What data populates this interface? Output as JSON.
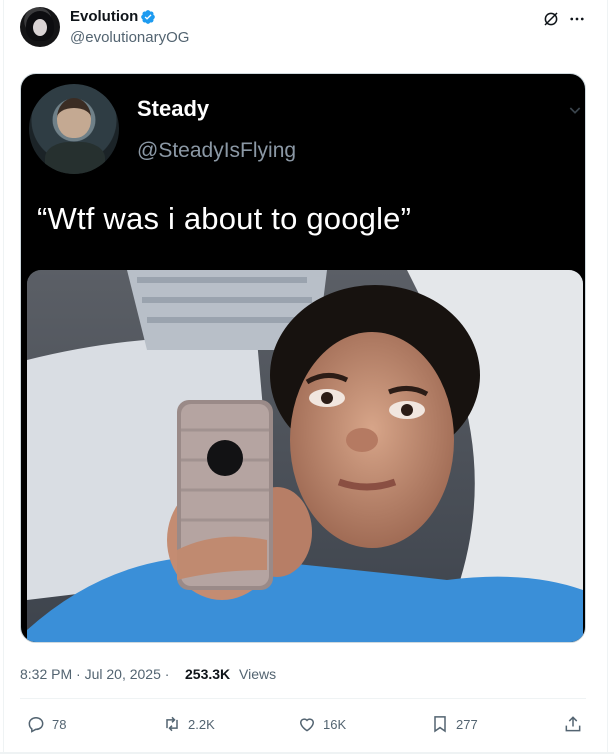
{
  "author": {
    "display_name": "Evolution",
    "handle": "@evolutionaryOG",
    "verified": true
  },
  "header_icons": [
    "grok-icon",
    "more-icon"
  ],
  "media": {
    "quoted_author": {
      "display_name": "Steady",
      "handle": "@SteadyIsFlying"
    },
    "quoted_text": "“Wtf was i about to google”",
    "photo": "young man lying in bed staring at phone"
  },
  "meta": {
    "timestamp": "8:32 PM · Jul 20, 2025 · ",
    "views_count": "253.3K",
    "views_label": "Views"
  },
  "actions": {
    "reply": "78",
    "retweet": "2.2K",
    "like": "16K",
    "bookmark": "277",
    "share": ""
  },
  "colors": {
    "accent": "#1d9bf0",
    "text_primary": "#0f1419",
    "text_secondary": "#536471",
    "border": "#eff3f4"
  }
}
